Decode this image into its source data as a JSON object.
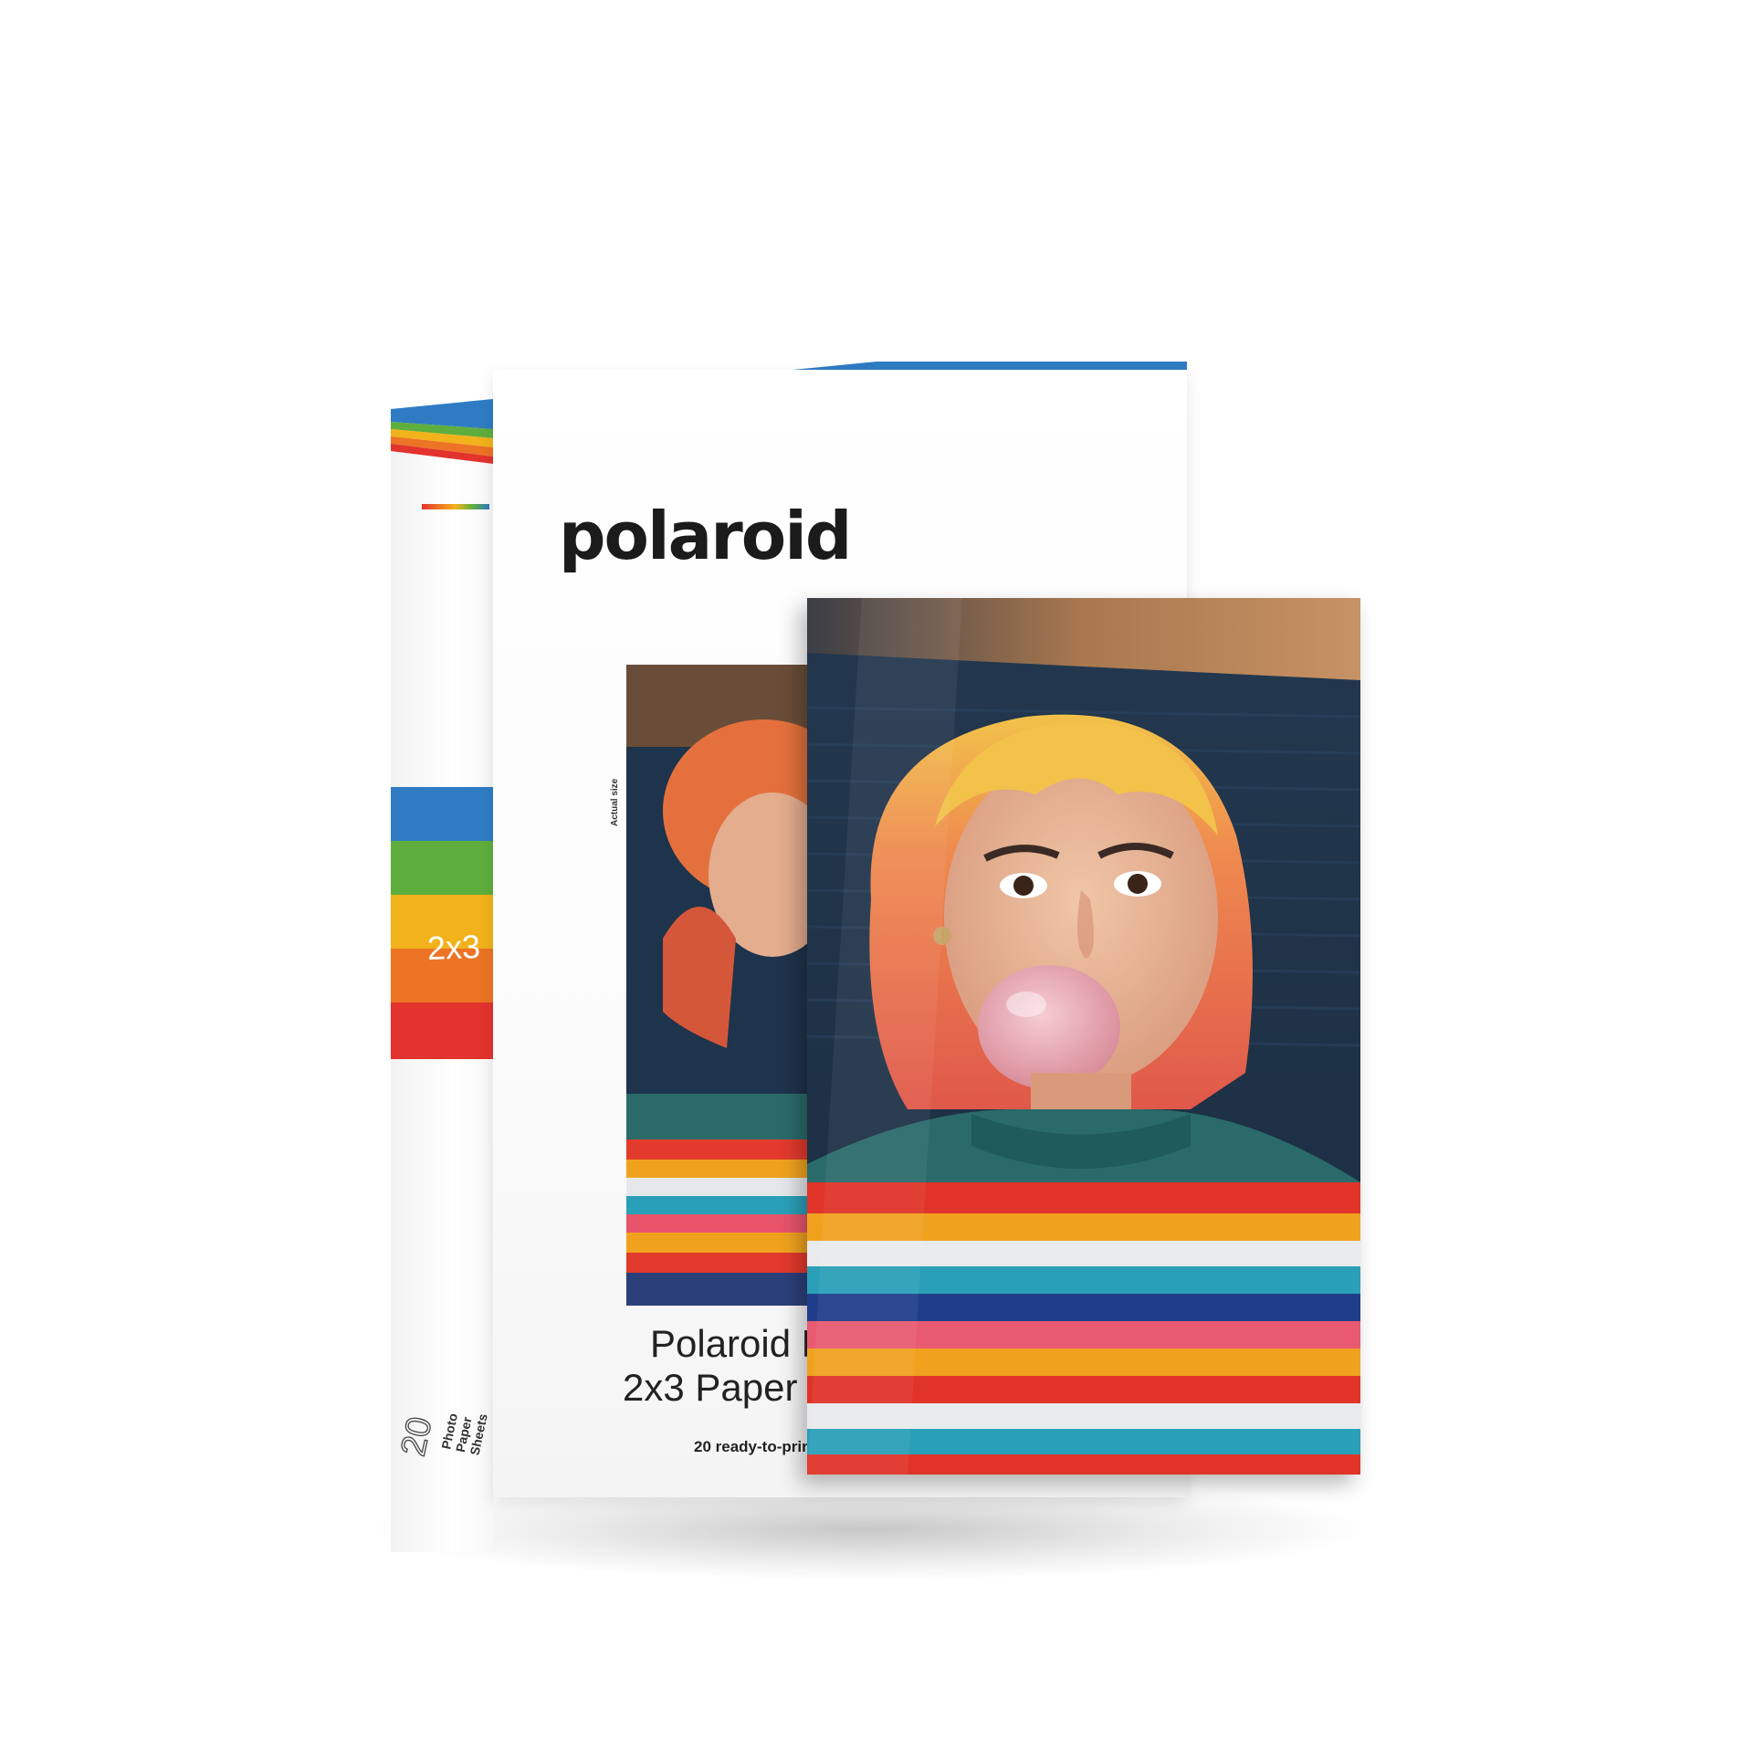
{
  "product": {
    "brand_logo": "polaroid",
    "format_badge": "2x3",
    "name_line1": "Polaroid Hi-Print",
    "name_line2": "2x3 Paper Cartridge",
    "tagline": "20 ready-to-print sheets",
    "sheet_count": "20",
    "sheet_count_label": "Photo Paper Sheets",
    "actual_size_note": "Actual size"
  },
  "colors": {
    "blue": "#2f7cc4",
    "green": "#5eae3d",
    "yellow": "#f2b21b",
    "orange": "#ec7424",
    "red": "#e2332d",
    "logo_text": "#1b1b1b"
  }
}
